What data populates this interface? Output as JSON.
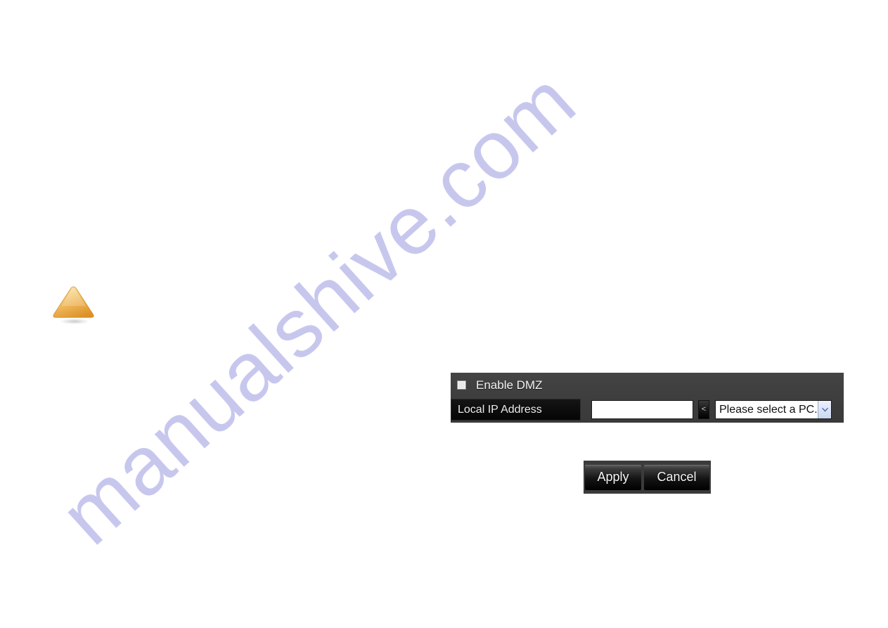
{
  "page": {
    "background_color": "#ffffff"
  },
  "watermark": {
    "text": "manualshive.com",
    "color": "#c7c7ee",
    "rotation_deg": -42
  },
  "notice_triangle": {
    "icon": "warning-triangle-icon",
    "fill_top_color": "#f7dd96",
    "fill_bottom_color": "#e09a33"
  },
  "dmz_panel": {
    "enable_checkbox": {
      "label": "Enable DMZ",
      "checked": false
    },
    "local_ip": {
      "label": "Local IP Address",
      "value": "",
      "placeholder": ""
    },
    "pick_button": {
      "label": "<"
    },
    "pc_select": {
      "selected": "Please select a PC.",
      "options": [
        "Please select a PC."
      ],
      "arrow_icon": "chevron-down-icon",
      "arrow_color": "#4a6fbd"
    },
    "colors": {
      "panel_background": "#3e3e3e",
      "label_background": "#0a0a0a",
      "label_text": "#ededed"
    }
  },
  "action_bar": {
    "apply_label": "Apply",
    "cancel_label": "Cancel",
    "background_color": "#3b3b3b",
    "button_text_color": "#f4f4f4"
  }
}
